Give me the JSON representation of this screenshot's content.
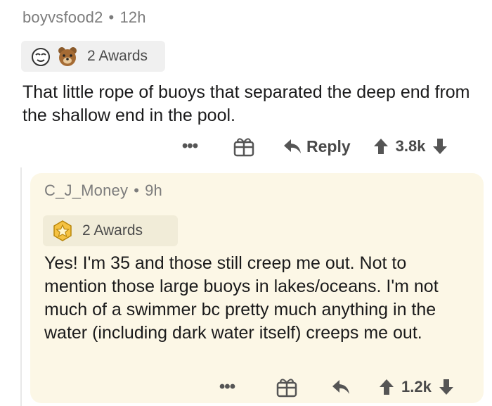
{
  "parent_comment": {
    "username": "boyvsfood2",
    "separator": "•",
    "age": "12h",
    "awards_label": "2 Awards",
    "award_icons": [
      "face-award-icon",
      "bear-award-icon"
    ],
    "text": "That little rope of buoys that separated the deep end from the shallow end in the pool.",
    "more_label": "•••",
    "reply_label": "Reply",
    "score": "3.8k"
  },
  "reply_comment": {
    "username": "C_J_Money",
    "separator": "•",
    "age": "9h",
    "awards_label": "2 Awards",
    "award_icons": [
      "star-award-icon"
    ],
    "text": "Yes! I'm 35 and those still creep me out. Not to mention those large buoys in lakes/oceans. I'm not much of a swimmer bc pretty much anything in the water (including dark water itself) creeps me out.",
    "more_label": "•••",
    "score": "1.2k"
  },
  "colors": {
    "reply_background": "#fcf7e6",
    "muted_text": "#7c7c7c",
    "award_pill": "#f0f0f0"
  }
}
